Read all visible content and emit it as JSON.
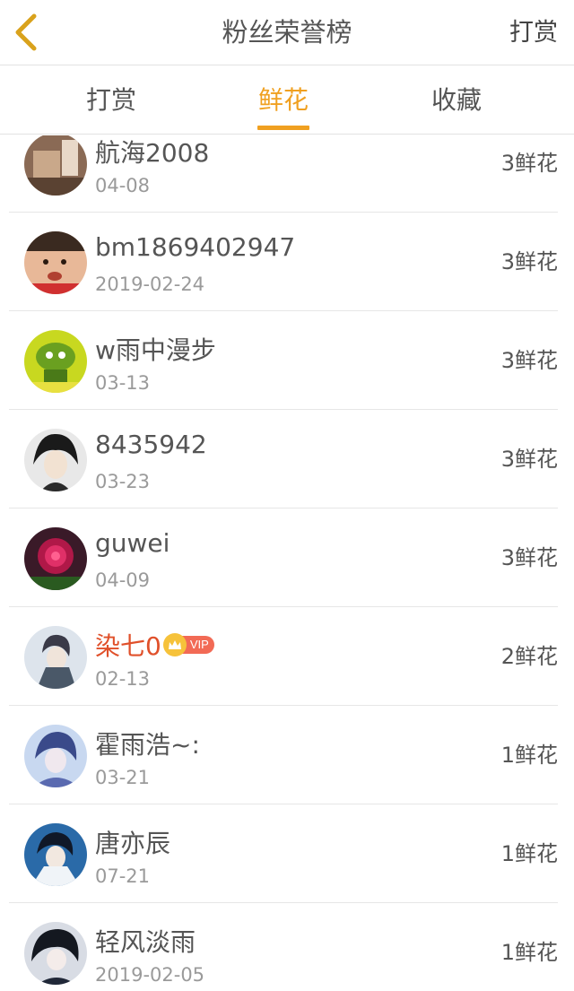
{
  "header": {
    "title": "粉丝荣誉榜",
    "right_action": "打赏"
  },
  "tabs": [
    {
      "label": "打赏"
    },
    {
      "label": "鲜花"
    },
    {
      "label": "收藏"
    }
  ],
  "active_tab": "鲜花",
  "fans": [
    {
      "name": "航海2008",
      "date": "04-08",
      "count": "3鲜花"
    },
    {
      "name": "bm1869402947",
      "date": "2019-02-24",
      "count": "3鲜花"
    },
    {
      "name": "w雨中漫步",
      "date": "03-13",
      "count": "3鲜花"
    },
    {
      "name": "8435942",
      "date": "03-23",
      "count": "3鲜花"
    },
    {
      "name": "guwei",
      "date": "04-09",
      "count": "3鲜花"
    },
    {
      "name": "染七0",
      "date": "02-13",
      "count": "2鲜花",
      "vip": "VIP"
    },
    {
      "name": "霍雨浩~:",
      "date": "03-21",
      "count": "1鲜花"
    },
    {
      "name": "唐亦辰",
      "date": "07-21",
      "count": "1鲜花"
    },
    {
      "name": "轻风淡雨",
      "date": "2019-02-05",
      "count": "1鲜花"
    }
  ],
  "colors": {
    "accent": "#f0a020",
    "vip_name": "#e0502a",
    "vip_badge": "#f26a55"
  }
}
